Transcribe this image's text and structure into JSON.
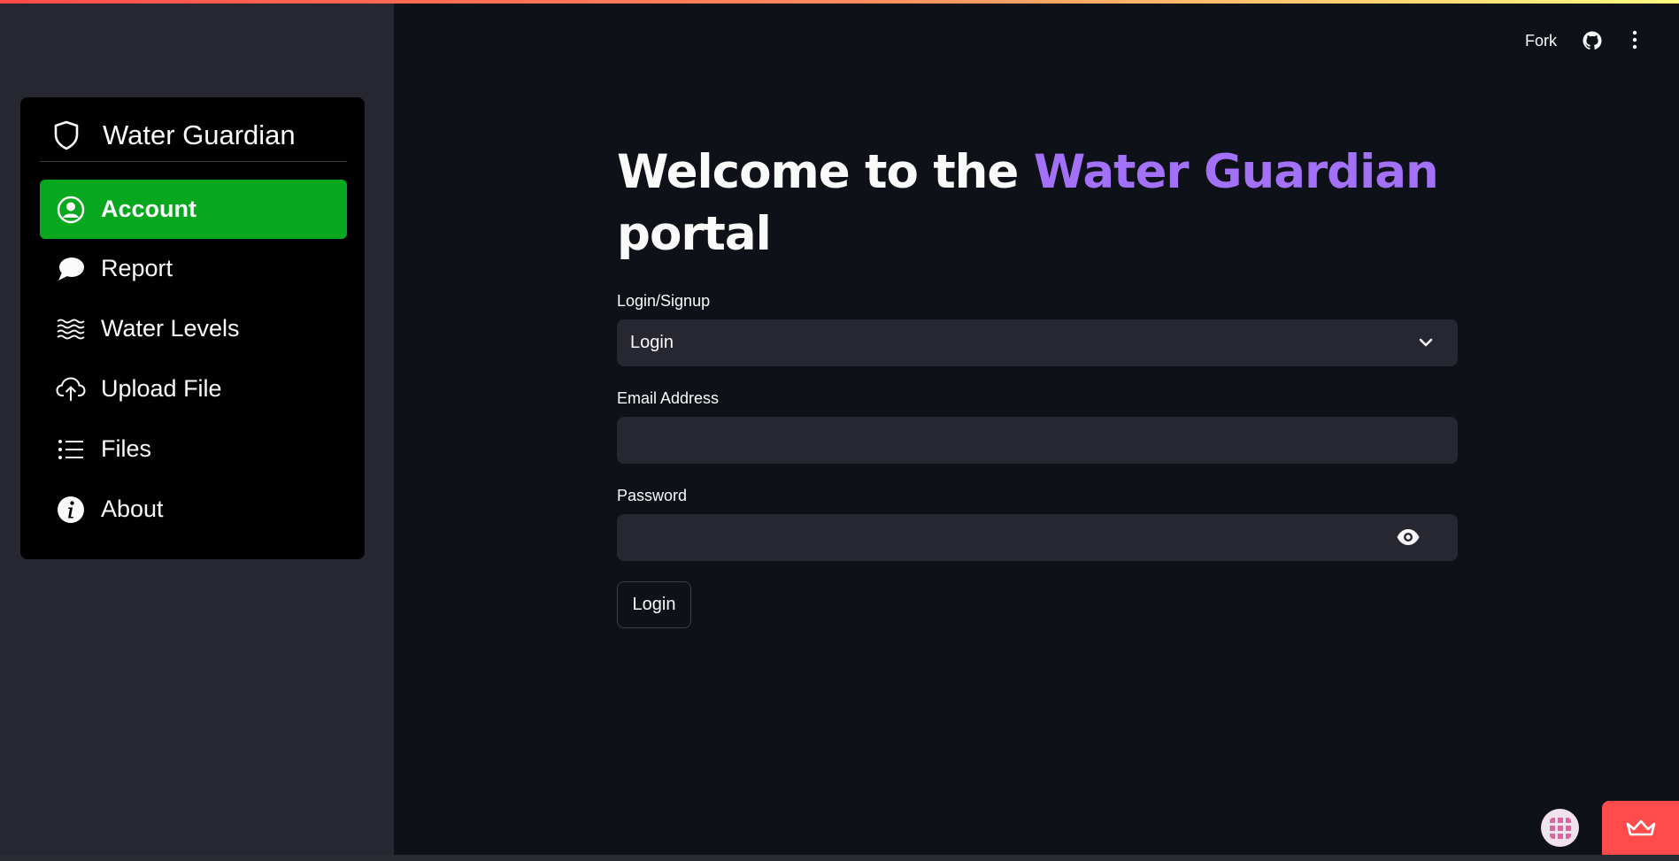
{
  "sidebar": {
    "menu_title": "Water Guardian",
    "items": [
      {
        "label": "Account",
        "icon": "person-circle-icon",
        "active": true
      },
      {
        "label": "Report",
        "icon": "chat-bubble-icon",
        "active": false
      },
      {
        "label": "Water Levels",
        "icon": "water-waves-icon",
        "active": false
      },
      {
        "label": "Upload File",
        "icon": "cloud-upload-icon",
        "active": false
      },
      {
        "label": "Files",
        "icon": "list-icon",
        "active": false
      },
      {
        "label": "About",
        "icon": "info-circle-icon",
        "active": false
      }
    ]
  },
  "header": {
    "fork_label": "Fork"
  },
  "main": {
    "heading_prefix": "Welcome to the ",
    "heading_accent": "Water Guardian",
    "heading_suffix": "portal",
    "login_signup_label": "Login/Signup",
    "login_signup_value": "Login",
    "email_label": "Email Address",
    "email_value": "",
    "password_label": "Password",
    "password_value": "",
    "submit_label": "Login"
  },
  "colors": {
    "accent": "#a371f7",
    "active_menu": "#07a81e",
    "sidebar_bg": "#262730",
    "page_bg": "#0e1117",
    "badge_red": "#ff4b4b"
  }
}
